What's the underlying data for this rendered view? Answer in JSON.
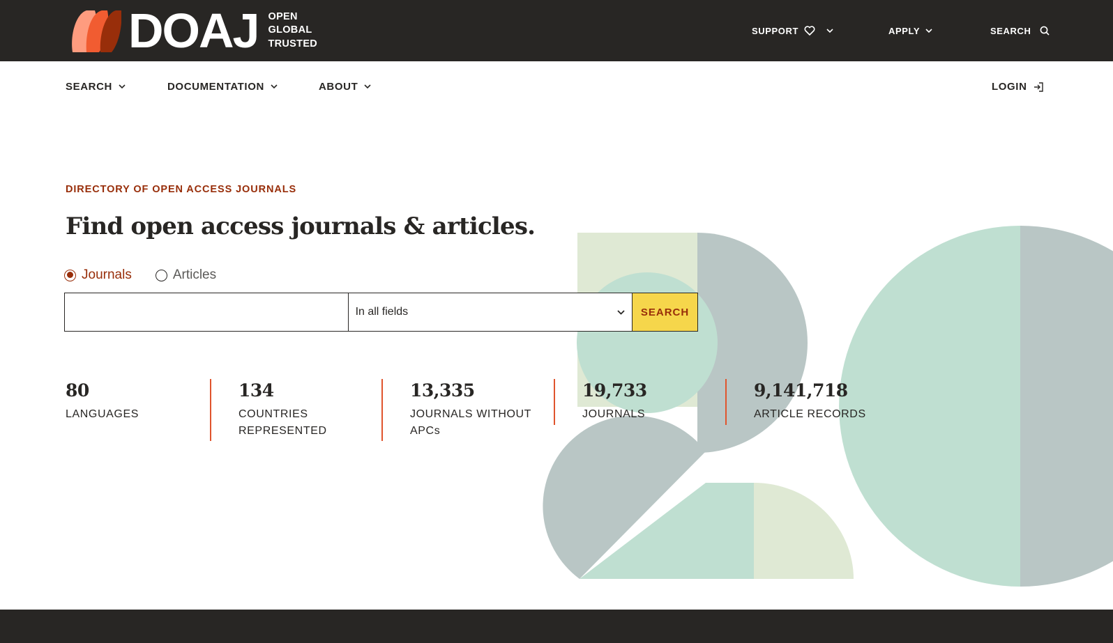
{
  "brand": {
    "name": "DOAJ",
    "tagline": [
      "OPEN",
      "GLOBAL",
      "TRUSTED"
    ]
  },
  "topnav": {
    "support": "SUPPORT",
    "apply": "APPLY",
    "search": "SEARCH"
  },
  "mainnav": {
    "search": "SEARCH",
    "documentation": "DOCUMENTATION",
    "about": "ABOUT",
    "login": "LOGIN"
  },
  "hero": {
    "eyebrow": "DIRECTORY OF OPEN ACCESS JOURNALS",
    "headline": "Find open access journals & articles.",
    "radios": {
      "journals": "Journals",
      "articles": "Articles",
      "selected": "journals"
    },
    "search": {
      "value": "",
      "field_selected": "In all fields",
      "button": "SEARCH"
    }
  },
  "stats": [
    {
      "value": "80",
      "label": "LANGUAGES"
    },
    {
      "value": "134",
      "label": "COUNTRIES REPRESENTED"
    },
    {
      "value": "13,335",
      "label": "JOURNALS WITHOUT APCs"
    },
    {
      "value": "19,733",
      "label": "JOURNALS"
    },
    {
      "value": "9,141,718",
      "label": "ARTICLE RECORDS"
    }
  ],
  "colors": {
    "dark": "#282624",
    "accent_red": "#982e0a",
    "divider_orange": "#e0542d",
    "button_yellow": "#f6d64b",
    "art_grey": "#b9c6c5",
    "art_mint": "#bfdfd1",
    "art_cream": "#dfe9d4"
  },
  "icons": {
    "support": "heart-icon",
    "dropdown": "chevron-down-icon",
    "search": "search-icon",
    "login": "login-arrow-icon"
  }
}
